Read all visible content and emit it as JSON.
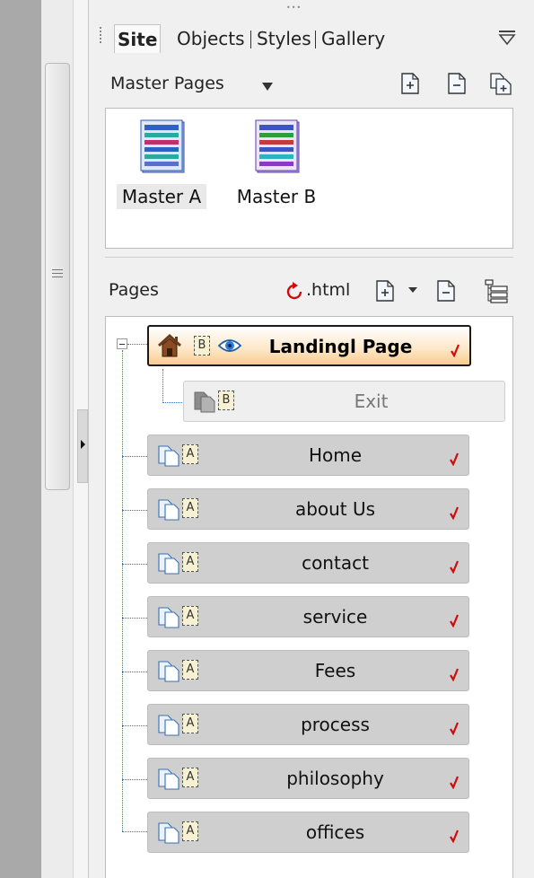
{
  "tabs": [
    {
      "label": "Site",
      "active": true
    },
    {
      "label": "Objects",
      "active": false
    },
    {
      "label": "Styles",
      "active": false
    },
    {
      "label": "Gallery",
      "active": false
    }
  ],
  "master_pages": {
    "label": "Master Pages",
    "items": [
      {
        "label": "Master A",
        "selected": true
      },
      {
        "label": "Master B",
        "selected": false
      }
    ],
    "toolbar_icons": [
      "new-master-icon",
      "delete-master-icon",
      "duplicate-master-icon"
    ]
  },
  "pages": {
    "label": "Pages",
    "html_label": ".html",
    "toolbar_icons": [
      "refresh-html-icon",
      "new-page-icon",
      "dropdown-arrow-icon",
      "delete-page-icon",
      "page-list-icon"
    ],
    "landing": {
      "name": "Landingl Page",
      "master": "B",
      "icons": [
        "home-icon",
        "preview-eye-icon",
        "checkmark-icon"
      ]
    },
    "exit": {
      "name": "Exit",
      "master": "B"
    },
    "items": [
      {
        "name": "Home",
        "master": "A"
      },
      {
        "name": "about Us",
        "master": "A"
      },
      {
        "name": "contact",
        "master": "A"
      },
      {
        "name": "service",
        "master": "A"
      },
      {
        "name": "Fees",
        "master": "A"
      },
      {
        "name": "process",
        "master": "A"
      },
      {
        "name": "philosophy",
        "master": "A"
      },
      {
        "name": "offices",
        "master": "A"
      }
    ]
  },
  "colors": {
    "landing_gradient_end": "#f8cc8f",
    "row_bg": "#cfcfcf",
    "check_red": "#d10a0a",
    "tree_line": "#3a6fb5"
  }
}
